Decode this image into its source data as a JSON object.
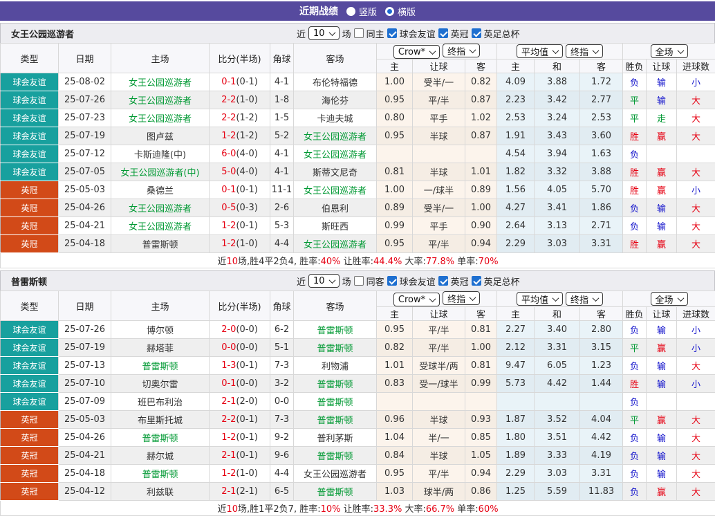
{
  "topbar": {
    "title": "近期战绩",
    "options": [
      {
        "label": "竖版",
        "selected": false
      },
      {
        "label": "横版",
        "selected": true
      }
    ]
  },
  "colors": {
    "accent_purple": "#564a9e",
    "friendly_badge_teal": "#18a09e",
    "league_badge_orange": "#d24a18",
    "highlight_team_green": "#009933",
    "win_big_red": "#e60012",
    "lose_small_blue": "#1414cc",
    "checkbox_blue": "#1e6fd0",
    "odds_cell_cream": "#fcf4ec",
    "avg_cell_blue": "#e9f3f8"
  },
  "table_header": {
    "main_cols": [
      "类型",
      "日期",
      "主场",
      "比分(半场)",
      "角球",
      "客场"
    ],
    "odds_group_selects": [
      "Crow*",
      "终指"
    ],
    "avg_group_selects": [
      "平均值",
      "终指"
    ],
    "result_group_select": "全场",
    "sub_cols": [
      "主",
      "让球",
      "客",
      "主",
      "和",
      "客",
      "胜负",
      "让球",
      "进球数"
    ]
  },
  "sections": [
    {
      "team": "女王公园巡游者",
      "filter": {
        "near": "近",
        "count": "10",
        "matches": "场",
        "same": {
          "label": "同主",
          "checked": false
        },
        "competitions": [
          {
            "label": "球会友谊",
            "checked": true
          },
          {
            "label": "英冠",
            "checked": true
          },
          {
            "label": "英足总杯",
            "checked": true
          }
        ]
      },
      "rows": [
        {
          "comp": "球会友谊",
          "comp_type": "friendly",
          "date": "25-08-02",
          "home": "女王公园巡游者",
          "home_hl": true,
          "score": "0-1",
          "half": "(0-1)",
          "corners": "4-1",
          "away": "布伦特福德",
          "away_hl": false,
          "odds_home": "1.00",
          "handicap": "受半/一",
          "odds_away": "0.82",
          "avg_home": "4.09",
          "avg_draw": "3.88",
          "avg_away": "1.72",
          "outcome": {
            "t": "负",
            "c": "b"
          },
          "handicap_res": {
            "t": "输",
            "c": "b"
          },
          "goals_res": {
            "t": "小",
            "c": "b"
          }
        },
        {
          "comp": "球会友谊",
          "comp_type": "friendly",
          "date": "25-07-26",
          "home": "女王公园巡游者",
          "home_hl": true,
          "score": "2-2",
          "half": "(1-0)",
          "corners": "1-8",
          "away": "海伦芬",
          "away_hl": false,
          "odds_home": "0.95",
          "handicap": "平/半",
          "odds_away": "0.87",
          "avg_home": "2.23",
          "avg_draw": "3.42",
          "avg_away": "2.77",
          "outcome": {
            "t": "平",
            "c": "g"
          },
          "handicap_res": {
            "t": "输",
            "c": "b"
          },
          "goals_res": {
            "t": "大",
            "c": "r"
          }
        },
        {
          "comp": "球会友谊",
          "comp_type": "friendly",
          "date": "25-07-23",
          "home": "女王公园巡游者",
          "home_hl": true,
          "score": "2-2",
          "half": "(1-2)",
          "corners": "1-5",
          "away": "卡迪夫城",
          "away_hl": false,
          "odds_home": "0.80",
          "handicap": "平手",
          "odds_away": "1.02",
          "avg_home": "2.53",
          "avg_draw": "3.24",
          "avg_away": "2.53",
          "outcome": {
            "t": "平",
            "c": "g"
          },
          "handicap_res": {
            "t": "走",
            "c": "g"
          },
          "goals_res": {
            "t": "大",
            "c": "r"
          }
        },
        {
          "comp": "球会友谊",
          "comp_type": "friendly",
          "date": "25-07-19",
          "home": "图卢兹",
          "home_hl": false,
          "score": "1-2",
          "half": "(1-2)",
          "corners": "5-2",
          "away": "女王公园巡游者",
          "away_hl": true,
          "odds_home": "0.95",
          "handicap": "半球",
          "odds_away": "0.87",
          "avg_home": "1.91",
          "avg_draw": "3.43",
          "avg_away": "3.60",
          "outcome": {
            "t": "胜",
            "c": "r"
          },
          "handicap_res": {
            "t": "赢",
            "c": "r"
          },
          "goals_res": {
            "t": "大",
            "c": "r"
          }
        },
        {
          "comp": "球会友谊",
          "comp_type": "friendly",
          "date": "25-07-12",
          "home": "卡斯迪隆(中)",
          "home_hl": false,
          "score": "6-0",
          "half": "(4-0)",
          "corners": "4-1",
          "away": "女王公园巡游者",
          "away_hl": true,
          "odds_home": "",
          "handicap": "",
          "odds_away": "",
          "avg_home": "4.54",
          "avg_draw": "3.94",
          "avg_away": "1.63",
          "outcome": {
            "t": "负",
            "c": "b"
          },
          "handicap_res": {
            "t": "",
            "c": "b"
          },
          "goals_res": {
            "t": "",
            "c": "b"
          }
        },
        {
          "comp": "球会友谊",
          "comp_type": "friendly",
          "date": "25-07-05",
          "home": "女王公园巡游者(中)",
          "home_hl": true,
          "score": "5-0",
          "half": "(4-0)",
          "corners": "4-1",
          "away": "斯蒂文尼奇",
          "away_hl": false,
          "odds_home": "0.81",
          "handicap": "半球",
          "odds_away": "1.01",
          "avg_home": "1.82",
          "avg_draw": "3.32",
          "avg_away": "3.88",
          "outcome": {
            "t": "胜",
            "c": "r"
          },
          "handicap_res": {
            "t": "赢",
            "c": "r"
          },
          "goals_res": {
            "t": "大",
            "c": "r"
          }
        },
        {
          "comp": "英冠",
          "comp_type": "league",
          "date": "25-05-03",
          "home": "桑德兰",
          "home_hl": false,
          "score": "0-1",
          "half": "(0-1)",
          "corners": "11-1",
          "away": "女王公园巡游者",
          "away_hl": true,
          "odds_home": "1.00",
          "handicap": "一/球半",
          "odds_away": "0.89",
          "avg_home": "1.56",
          "avg_draw": "4.05",
          "avg_away": "5.70",
          "outcome": {
            "t": "胜",
            "c": "r"
          },
          "handicap_res": {
            "t": "赢",
            "c": "r"
          },
          "goals_res": {
            "t": "小",
            "c": "b"
          }
        },
        {
          "comp": "英冠",
          "comp_type": "league",
          "date": "25-04-26",
          "home": "女王公园巡游者",
          "home_hl": true,
          "score": "0-5",
          "half": "(0-3)",
          "corners": "2-6",
          "away": "伯恩利",
          "away_hl": false,
          "odds_home": "0.89",
          "handicap": "受半/一",
          "odds_away": "1.00",
          "avg_home": "4.27",
          "avg_draw": "3.41",
          "avg_away": "1.86",
          "outcome": {
            "t": "负",
            "c": "b"
          },
          "handicap_res": {
            "t": "输",
            "c": "b"
          },
          "goals_res": {
            "t": "大",
            "c": "r"
          }
        },
        {
          "comp": "英冠",
          "comp_type": "league",
          "date": "25-04-21",
          "home": "女王公园巡游者",
          "home_hl": true,
          "score": "1-2",
          "half": "(0-1)",
          "corners": "5-3",
          "away": "斯旺西",
          "away_hl": false,
          "odds_home": "0.99",
          "handicap": "平手",
          "odds_away": "0.90",
          "avg_home": "2.64",
          "avg_draw": "3.13",
          "avg_away": "2.71",
          "outcome": {
            "t": "负",
            "c": "b"
          },
          "handicap_res": {
            "t": "输",
            "c": "b"
          },
          "goals_res": {
            "t": "大",
            "c": "r"
          }
        },
        {
          "comp": "英冠",
          "comp_type": "league",
          "date": "25-04-18",
          "home": "普雷斯顿",
          "home_hl": false,
          "score": "1-2",
          "half": "(1-0)",
          "corners": "4-4",
          "away": "女王公园巡游者",
          "away_hl": true,
          "odds_home": "0.95",
          "handicap": "平/半",
          "odds_away": "0.94",
          "avg_home": "2.29",
          "avg_draw": "3.03",
          "avg_away": "3.31",
          "outcome": {
            "t": "胜",
            "c": "r"
          },
          "handicap_res": {
            "t": "赢",
            "c": "r"
          },
          "goals_res": {
            "t": "大",
            "c": "r"
          }
        }
      ],
      "summary": [
        {
          "t": "近",
          "c": "k"
        },
        {
          "t": "10",
          "c": "r"
        },
        {
          "t": "场,胜4平2负4, 胜率:",
          "c": "k"
        },
        {
          "t": "40%",
          "c": "r"
        },
        {
          "t": " 让胜率:",
          "c": "k"
        },
        {
          "t": "44.4%",
          "c": "r"
        },
        {
          "t": " 大率:",
          "c": "k"
        },
        {
          "t": "77.8%",
          "c": "r"
        },
        {
          "t": " 单率:",
          "c": "k"
        },
        {
          "t": "70%",
          "c": "r"
        }
      ]
    },
    {
      "team": "普雷斯顿",
      "filter": {
        "near": "近",
        "count": "10",
        "matches": "场",
        "same": {
          "label": "同客",
          "checked": false
        },
        "competitions": [
          {
            "label": "球会友谊",
            "checked": true
          },
          {
            "label": "英冠",
            "checked": true
          },
          {
            "label": "英足总杯",
            "checked": true
          }
        ]
      },
      "rows": [
        {
          "comp": "球会友谊",
          "comp_type": "friendly",
          "date": "25-07-26",
          "home": "博尔顿",
          "home_hl": false,
          "score": "2-0",
          "half": "(0-0)",
          "corners": "6-2",
          "away": "普雷斯顿",
          "away_hl": true,
          "odds_home": "0.95",
          "handicap": "平/半",
          "odds_away": "0.81",
          "avg_home": "2.27",
          "avg_draw": "3.40",
          "avg_away": "2.80",
          "outcome": {
            "t": "负",
            "c": "b"
          },
          "handicap_res": {
            "t": "输",
            "c": "b"
          },
          "goals_res": {
            "t": "小",
            "c": "b"
          }
        },
        {
          "comp": "球会友谊",
          "comp_type": "friendly",
          "date": "25-07-19",
          "home": "赫塔菲",
          "home_hl": false,
          "score": "0-0",
          "half": "(0-0)",
          "corners": "5-1",
          "away": "普雷斯顿",
          "away_hl": true,
          "odds_home": "0.82",
          "handicap": "平/半",
          "odds_away": "1.00",
          "avg_home": "2.12",
          "avg_draw": "3.31",
          "avg_away": "3.15",
          "outcome": {
            "t": "平",
            "c": "g"
          },
          "handicap_res": {
            "t": "赢",
            "c": "r"
          },
          "goals_res": {
            "t": "小",
            "c": "b"
          }
        },
        {
          "comp": "球会友谊",
          "comp_type": "friendly",
          "date": "25-07-13",
          "home": "普雷斯顿",
          "home_hl": true,
          "score": "1-3",
          "half": "(0-1)",
          "corners": "7-3",
          "away": "利物浦",
          "away_hl": false,
          "odds_home": "1.01",
          "handicap": "受球半/两",
          "odds_away": "0.81",
          "avg_home": "9.47",
          "avg_draw": "6.05",
          "avg_away": "1.23",
          "outcome": {
            "t": "负",
            "c": "b"
          },
          "handicap_res": {
            "t": "输",
            "c": "b"
          },
          "goals_res": {
            "t": "大",
            "c": "r"
          }
        },
        {
          "comp": "球会友谊",
          "comp_type": "friendly",
          "date": "25-07-10",
          "home": "切奥尔雷",
          "home_hl": false,
          "score": "0-1",
          "half": "(0-0)",
          "corners": "3-2",
          "away": "普雷斯顿",
          "away_hl": true,
          "odds_home": "0.83",
          "handicap": "受一/球半",
          "odds_away": "0.99",
          "avg_home": "5.73",
          "avg_draw": "4.42",
          "avg_away": "1.44",
          "outcome": {
            "t": "胜",
            "c": "r"
          },
          "handicap_res": {
            "t": "输",
            "c": "b"
          },
          "goals_res": {
            "t": "小",
            "c": "b"
          }
        },
        {
          "comp": "球会友谊",
          "comp_type": "friendly",
          "date": "25-07-09",
          "home": "班巴布利治",
          "home_hl": false,
          "score": "2-1",
          "half": "(2-0)",
          "corners": "0-0",
          "away": "普雷斯顿",
          "away_hl": true,
          "odds_home": "",
          "handicap": "",
          "odds_away": "",
          "avg_home": "",
          "avg_draw": "",
          "avg_away": "",
          "outcome": {
            "t": "负",
            "c": "b"
          },
          "handicap_res": {
            "t": "",
            "c": "b"
          },
          "goals_res": {
            "t": "",
            "c": "b"
          }
        },
        {
          "comp": "英冠",
          "comp_type": "league",
          "date": "25-05-03",
          "home": "布里斯托城",
          "home_hl": false,
          "score": "2-2",
          "half": "(0-1)",
          "corners": "7-3",
          "away": "普雷斯顿",
          "away_hl": true,
          "odds_home": "0.96",
          "handicap": "半球",
          "odds_away": "0.93",
          "avg_home": "1.87",
          "avg_draw": "3.52",
          "avg_away": "4.04",
          "outcome": {
            "t": "平",
            "c": "g"
          },
          "handicap_res": {
            "t": "赢",
            "c": "r"
          },
          "goals_res": {
            "t": "大",
            "c": "r"
          }
        },
        {
          "comp": "英冠",
          "comp_type": "league",
          "date": "25-04-26",
          "home": "普雷斯顿",
          "home_hl": true,
          "score": "1-2",
          "half": "(0-1)",
          "corners": "9-2",
          "away": "普利茅斯",
          "away_hl": false,
          "odds_home": "1.04",
          "handicap": "半/一",
          "odds_away": "0.85",
          "avg_home": "1.80",
          "avg_draw": "3.51",
          "avg_away": "4.42",
          "outcome": {
            "t": "负",
            "c": "b"
          },
          "handicap_res": {
            "t": "输",
            "c": "b"
          },
          "goals_res": {
            "t": "大",
            "c": "r"
          }
        },
        {
          "comp": "英冠",
          "comp_type": "league",
          "date": "25-04-21",
          "home": "赫尔城",
          "home_hl": false,
          "score": "2-1",
          "half": "(0-1)",
          "corners": "9-6",
          "away": "普雷斯顿",
          "away_hl": true,
          "odds_home": "0.84",
          "handicap": "半球",
          "odds_away": "1.05",
          "avg_home": "1.89",
          "avg_draw": "3.33",
          "avg_away": "4.19",
          "outcome": {
            "t": "负",
            "c": "b"
          },
          "handicap_res": {
            "t": "输",
            "c": "b"
          },
          "goals_res": {
            "t": "大",
            "c": "r"
          }
        },
        {
          "comp": "英冠",
          "comp_type": "league",
          "date": "25-04-18",
          "home": "普雷斯顿",
          "home_hl": true,
          "score": "1-2",
          "half": "(1-0)",
          "corners": "4-4",
          "away": "女王公园巡游者",
          "away_hl": false,
          "odds_home": "0.95",
          "handicap": "平/半",
          "odds_away": "0.94",
          "avg_home": "2.29",
          "avg_draw": "3.03",
          "avg_away": "3.31",
          "outcome": {
            "t": "负",
            "c": "b"
          },
          "handicap_res": {
            "t": "输",
            "c": "b"
          },
          "goals_res": {
            "t": "大",
            "c": "r"
          }
        },
        {
          "comp": "英冠",
          "comp_type": "league",
          "date": "25-04-12",
          "home": "利兹联",
          "home_hl": false,
          "score": "2-1",
          "half": "(2-1)",
          "corners": "6-5",
          "away": "普雷斯顿",
          "away_hl": true,
          "odds_home": "1.03",
          "handicap": "球半/两",
          "odds_away": "0.86",
          "avg_home": "1.25",
          "avg_draw": "5.59",
          "avg_away": "11.83",
          "outcome": {
            "t": "负",
            "c": "b"
          },
          "handicap_res": {
            "t": "赢",
            "c": "r"
          },
          "goals_res": {
            "t": "大",
            "c": "r"
          }
        }
      ],
      "summary": [
        {
          "t": "近",
          "c": "k"
        },
        {
          "t": "10",
          "c": "r"
        },
        {
          "t": "场,胜1平2负7, 胜率:",
          "c": "k"
        },
        {
          "t": "10%",
          "c": "r"
        },
        {
          "t": " 让胜率:",
          "c": "k"
        },
        {
          "t": "33.3%",
          "c": "r"
        },
        {
          "t": " 大率:",
          "c": "k"
        },
        {
          "t": "66.7%",
          "c": "r"
        },
        {
          "t": " 单率:",
          "c": "k"
        },
        {
          "t": "60%",
          "c": "r"
        }
      ]
    }
  ]
}
